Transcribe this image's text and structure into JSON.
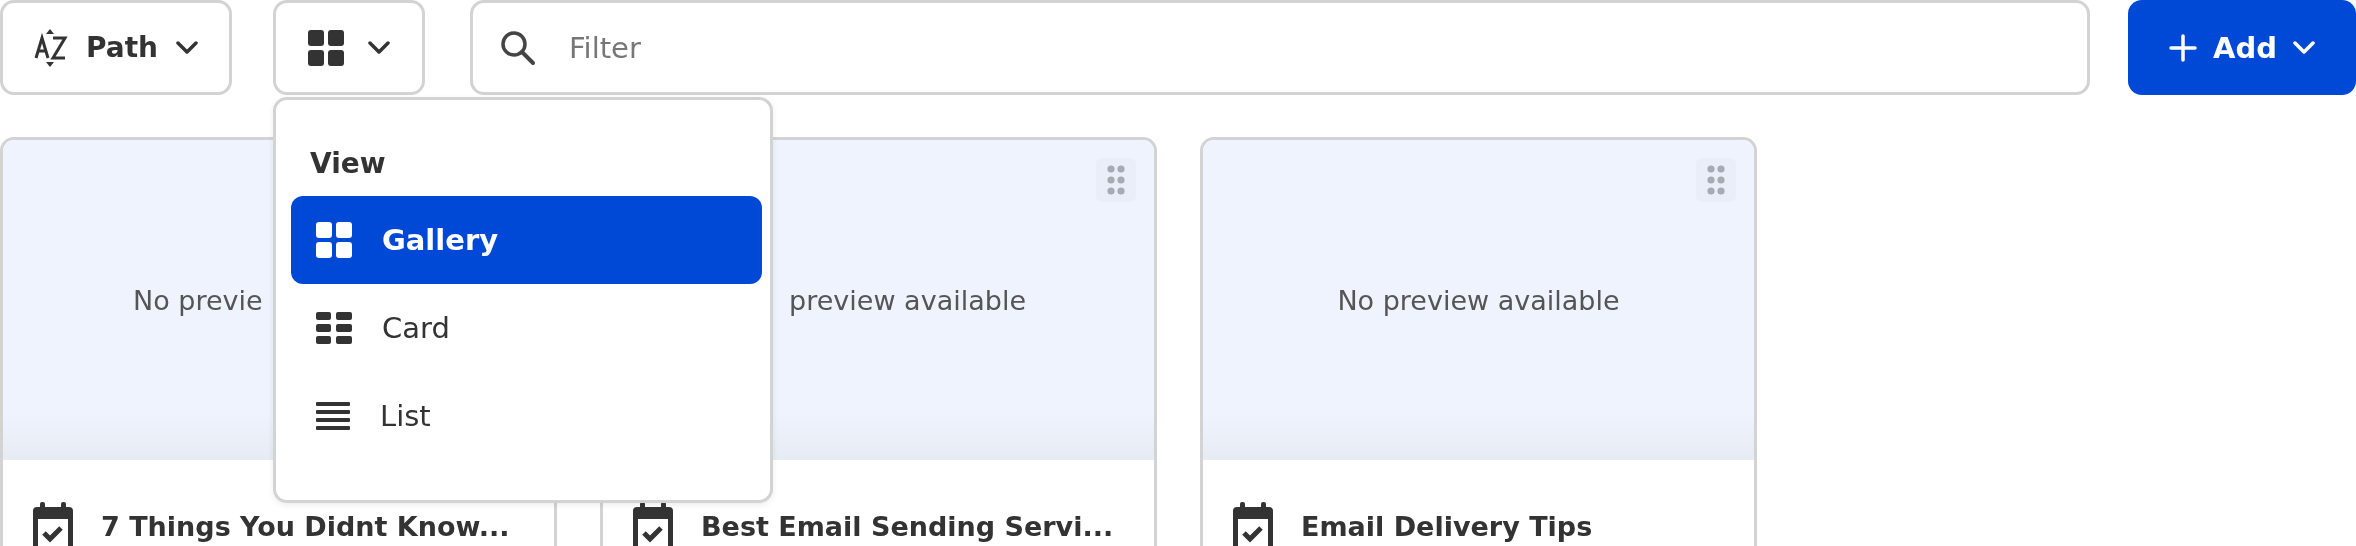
{
  "toolbar": {
    "sort_button": {
      "label": "Path"
    },
    "filter": {
      "placeholder": "Filter"
    },
    "add_button": {
      "label": "Add"
    }
  },
  "view_menu": {
    "heading": "View",
    "items": [
      {
        "label": "Gallery",
        "kind": "gallery",
        "selected": true
      },
      {
        "label": "Card",
        "kind": "card",
        "selected": false
      },
      {
        "label": "List",
        "kind": "list",
        "selected": false
      }
    ]
  },
  "cards": [
    {
      "preview_text": "No previe",
      "title": "7 Things You Didnt Know..."
    },
    {
      "preview_text": "preview available",
      "drag_handle": true,
      "title": "Best Email Sending Servi..."
    },
    {
      "preview_text": "No preview available",
      "drag_handle": true,
      "title": "Email Delivery Tips"
    }
  ]
}
